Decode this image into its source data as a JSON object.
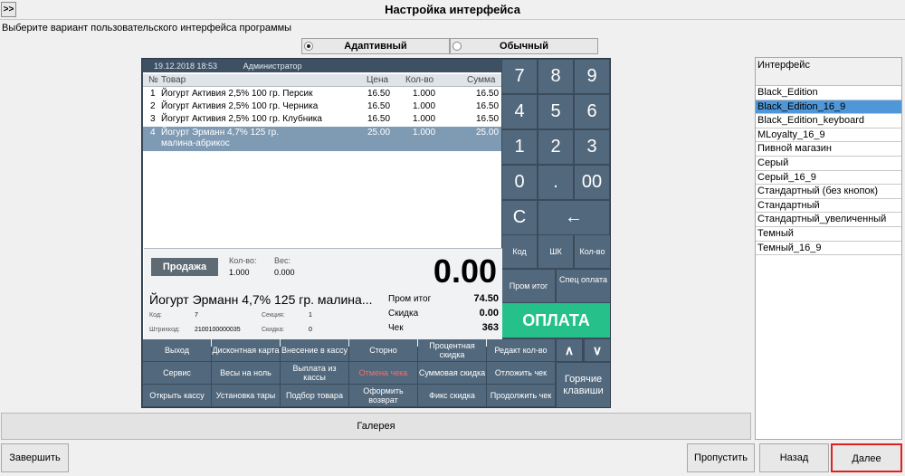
{
  "window": {
    "title": "Настройка интерфейса",
    "expand_label": ">>"
  },
  "subtitle": "Выберите вариант пользовательского интерфейса программы",
  "modes": [
    {
      "label": "Адаптивный",
      "selected": true
    },
    {
      "label": "Обычный",
      "selected": false
    }
  ],
  "preview": {
    "header": {
      "datetime": "19.12.2018 18:53",
      "user": "Администратор"
    },
    "columns": {
      "num": "№",
      "item": "Товар",
      "price": "Цена",
      "qty": "Кол-во",
      "sum": "Сумма"
    },
    "rows": [
      {
        "n": "1",
        "name": "Йогурт Активия 2,5% 100 гр. Персик",
        "price": "16.50",
        "qty": "1.000",
        "sum": "16.50"
      },
      {
        "n": "2",
        "name": "Йогурт Активия 2,5% 100 гр. Черника",
        "price": "16.50",
        "qty": "1.000",
        "sum": "16.50"
      },
      {
        "n": "3",
        "name": "Йогурт Активия 2,5% 100 гр. Клубника",
        "price": "16.50",
        "qty": "1.000",
        "sum": "16.50"
      },
      {
        "n": "4",
        "name": "Йогурт Эрманн 4,7% 125 гр.",
        "name2": "малина-абрикос",
        "price": "25.00",
        "qty": "1.000",
        "sum": "25.00"
      }
    ],
    "sale": {
      "label": "Продажа",
      "qty_label": "Кол-во:",
      "qty_value": "1.000",
      "weight_label": "Вес:",
      "weight_value": "0.000",
      "total": "0.00",
      "product": "Йогурт Эрманн 4,7% 125 гр. малина...",
      "code_label": "Код:",
      "code_value": "7",
      "section_label": "Секция:",
      "section_value": "1",
      "barcode_label": "Штрихкод:",
      "barcode_value": "2100100000035",
      "count_label": "Скидка:",
      "count_value": "0",
      "subtotal_label": "Пром итог",
      "subtotal_value": "74.50",
      "discount_label": "Скидка",
      "discount_value": "0.00",
      "check_label": "Чек",
      "check_value": "363"
    },
    "numpad": [
      "7",
      "8",
      "9",
      "4",
      "5",
      "6",
      "1",
      "2",
      "3",
      "0",
      ".",
      "00",
      "С",
      "←"
    ],
    "fn_keys": {
      "code": "Код",
      "barcode": "ШК",
      "qty": "Кол-во",
      "subtotal": "Пром итог",
      "special": "Спец оплата"
    },
    "pay": "ОПЛАТА",
    "grid": [
      "Выход",
      "Дисконтная карта",
      "Внесение в кассу",
      "Сторно",
      "Процентная скидка",
      "Редакт кол-во",
      "Сервис",
      "Весы на ноль",
      "Выплата из кассы",
      "Отмена чека",
      "Суммовая скидка",
      "Отложить чек",
      "Открыть кассу",
      "Установка тары",
      "Подбор товара",
      "Оформить возврат",
      "Фикс скидка",
      "Продолжить чек"
    ],
    "arrows": {
      "up": "∧",
      "down": "∨"
    },
    "hotkeys": "Горячие клавиши"
  },
  "gallery": "Галерея",
  "list": {
    "header": "Интерфейс",
    "items": [
      "Black_Edition",
      "Black_Edition_16_9",
      "Black_Edition_keyboard",
      "MLoyalty_16_9",
      "Пивной магазин",
      "Серый",
      "Серый_16_9",
      "Стандартный (без кнопок)",
      "Стандартный",
      "Стандартный_увеличенный",
      "Темный",
      "Темный_16_9"
    ],
    "selected_index": 1
  },
  "buttons": {
    "finish": "Завершить",
    "skip": "Пропустить",
    "back": "Назад",
    "next": "Далее"
  },
  "colors": {
    "accent": "#4e97d8",
    "pay": "#26c08a",
    "preview_bg": "#3a4b5c",
    "focus": "#e02020"
  }
}
